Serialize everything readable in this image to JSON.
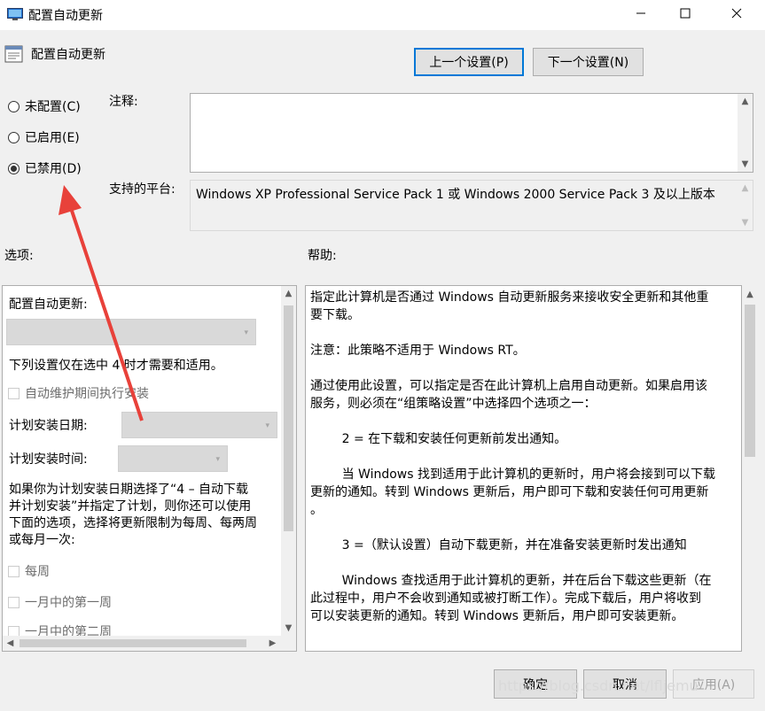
{
  "window": {
    "title": "配置自动更新"
  },
  "header": {
    "policy_name": "配置自动更新",
    "prev_button": "上一个设置(P)",
    "next_button": "下一个设置(N)"
  },
  "state": {
    "options": [
      {
        "label": "未配置(C)",
        "selected": false
      },
      {
        "label": "已启用(E)",
        "selected": false
      },
      {
        "label": "已禁用(D)",
        "selected": true
      }
    ]
  },
  "comment": {
    "label": "注释:",
    "value": ""
  },
  "platform": {
    "label": "支持的平台:",
    "value": "Windows XP Professional Service Pack 1 或 Windows 2000 Service Pack 3 及以上版本"
  },
  "options_panel": {
    "label": "选项:",
    "configure_label": "配置自动更新:",
    "note": "下列设置仅在选中 4 时才需要和适用。",
    "maintenance_install": "自动维护期间执行安装",
    "schedule_day_label": "计划安装日期:",
    "schedule_time_label": "计划安装时间:",
    "para": [
      "如果你为计划安装日期选择了“4 – 自动下载",
      "并计划安装”并指定了计划，则你还可以使用",
      "下面的选项，选择将更新限制为每周、每两周",
      "或每月一次:"
    ],
    "weekly": "每周",
    "first_week": "一月中的第一周",
    "second_week": "一月中的第二周"
  },
  "help_panel": {
    "label": "帮助:",
    "lines": [
      "指定此计算机是否通过 Windows 自动更新服务来接收安全更新和其他重",
      "要下载。",
      "",
      "注意：此策略不适用于 Windows RT。",
      "",
      "通过使用此设置，可以指定是否在此计算机上启用自动更新。如果启用该",
      "服务，则必须在“组策略设置”中选择四个选项之一：",
      "",
      "        2 = 在下载和安装任何更新前发出通知。",
      "",
      "        当 Windows 找到适用于此计算机的更新时，用户将会接到可以下载",
      "更新的通知。转到 Windows 更新后，用户即可下载和安装任何可用更新",
      "。",
      "",
      "        3 =（默认设置）自动下载更新，并在准备安装更新时发出通知",
      "",
      "        Windows 查找适用于此计算机的更新，并在后台下载这些更新（在",
      "此过程中，用户不会收到通知或被打断工作）。完成下载后，用户将收到",
      "可以安装更新的通知。转到 Windows 更新后，用户即可安装更新。"
    ]
  },
  "footer": {
    "ok": "确定",
    "cancel": "取消",
    "apply": "应用(A)",
    "watermark": "https://blog.csdn.net/lfljemu"
  },
  "colors": {
    "annotation_arrow": "#e8413a",
    "primary_border": "#0078d7"
  },
  "icons": [
    "app-icon",
    "policy-icon",
    "minimize-icon",
    "maximize-icon",
    "close-icon"
  ]
}
